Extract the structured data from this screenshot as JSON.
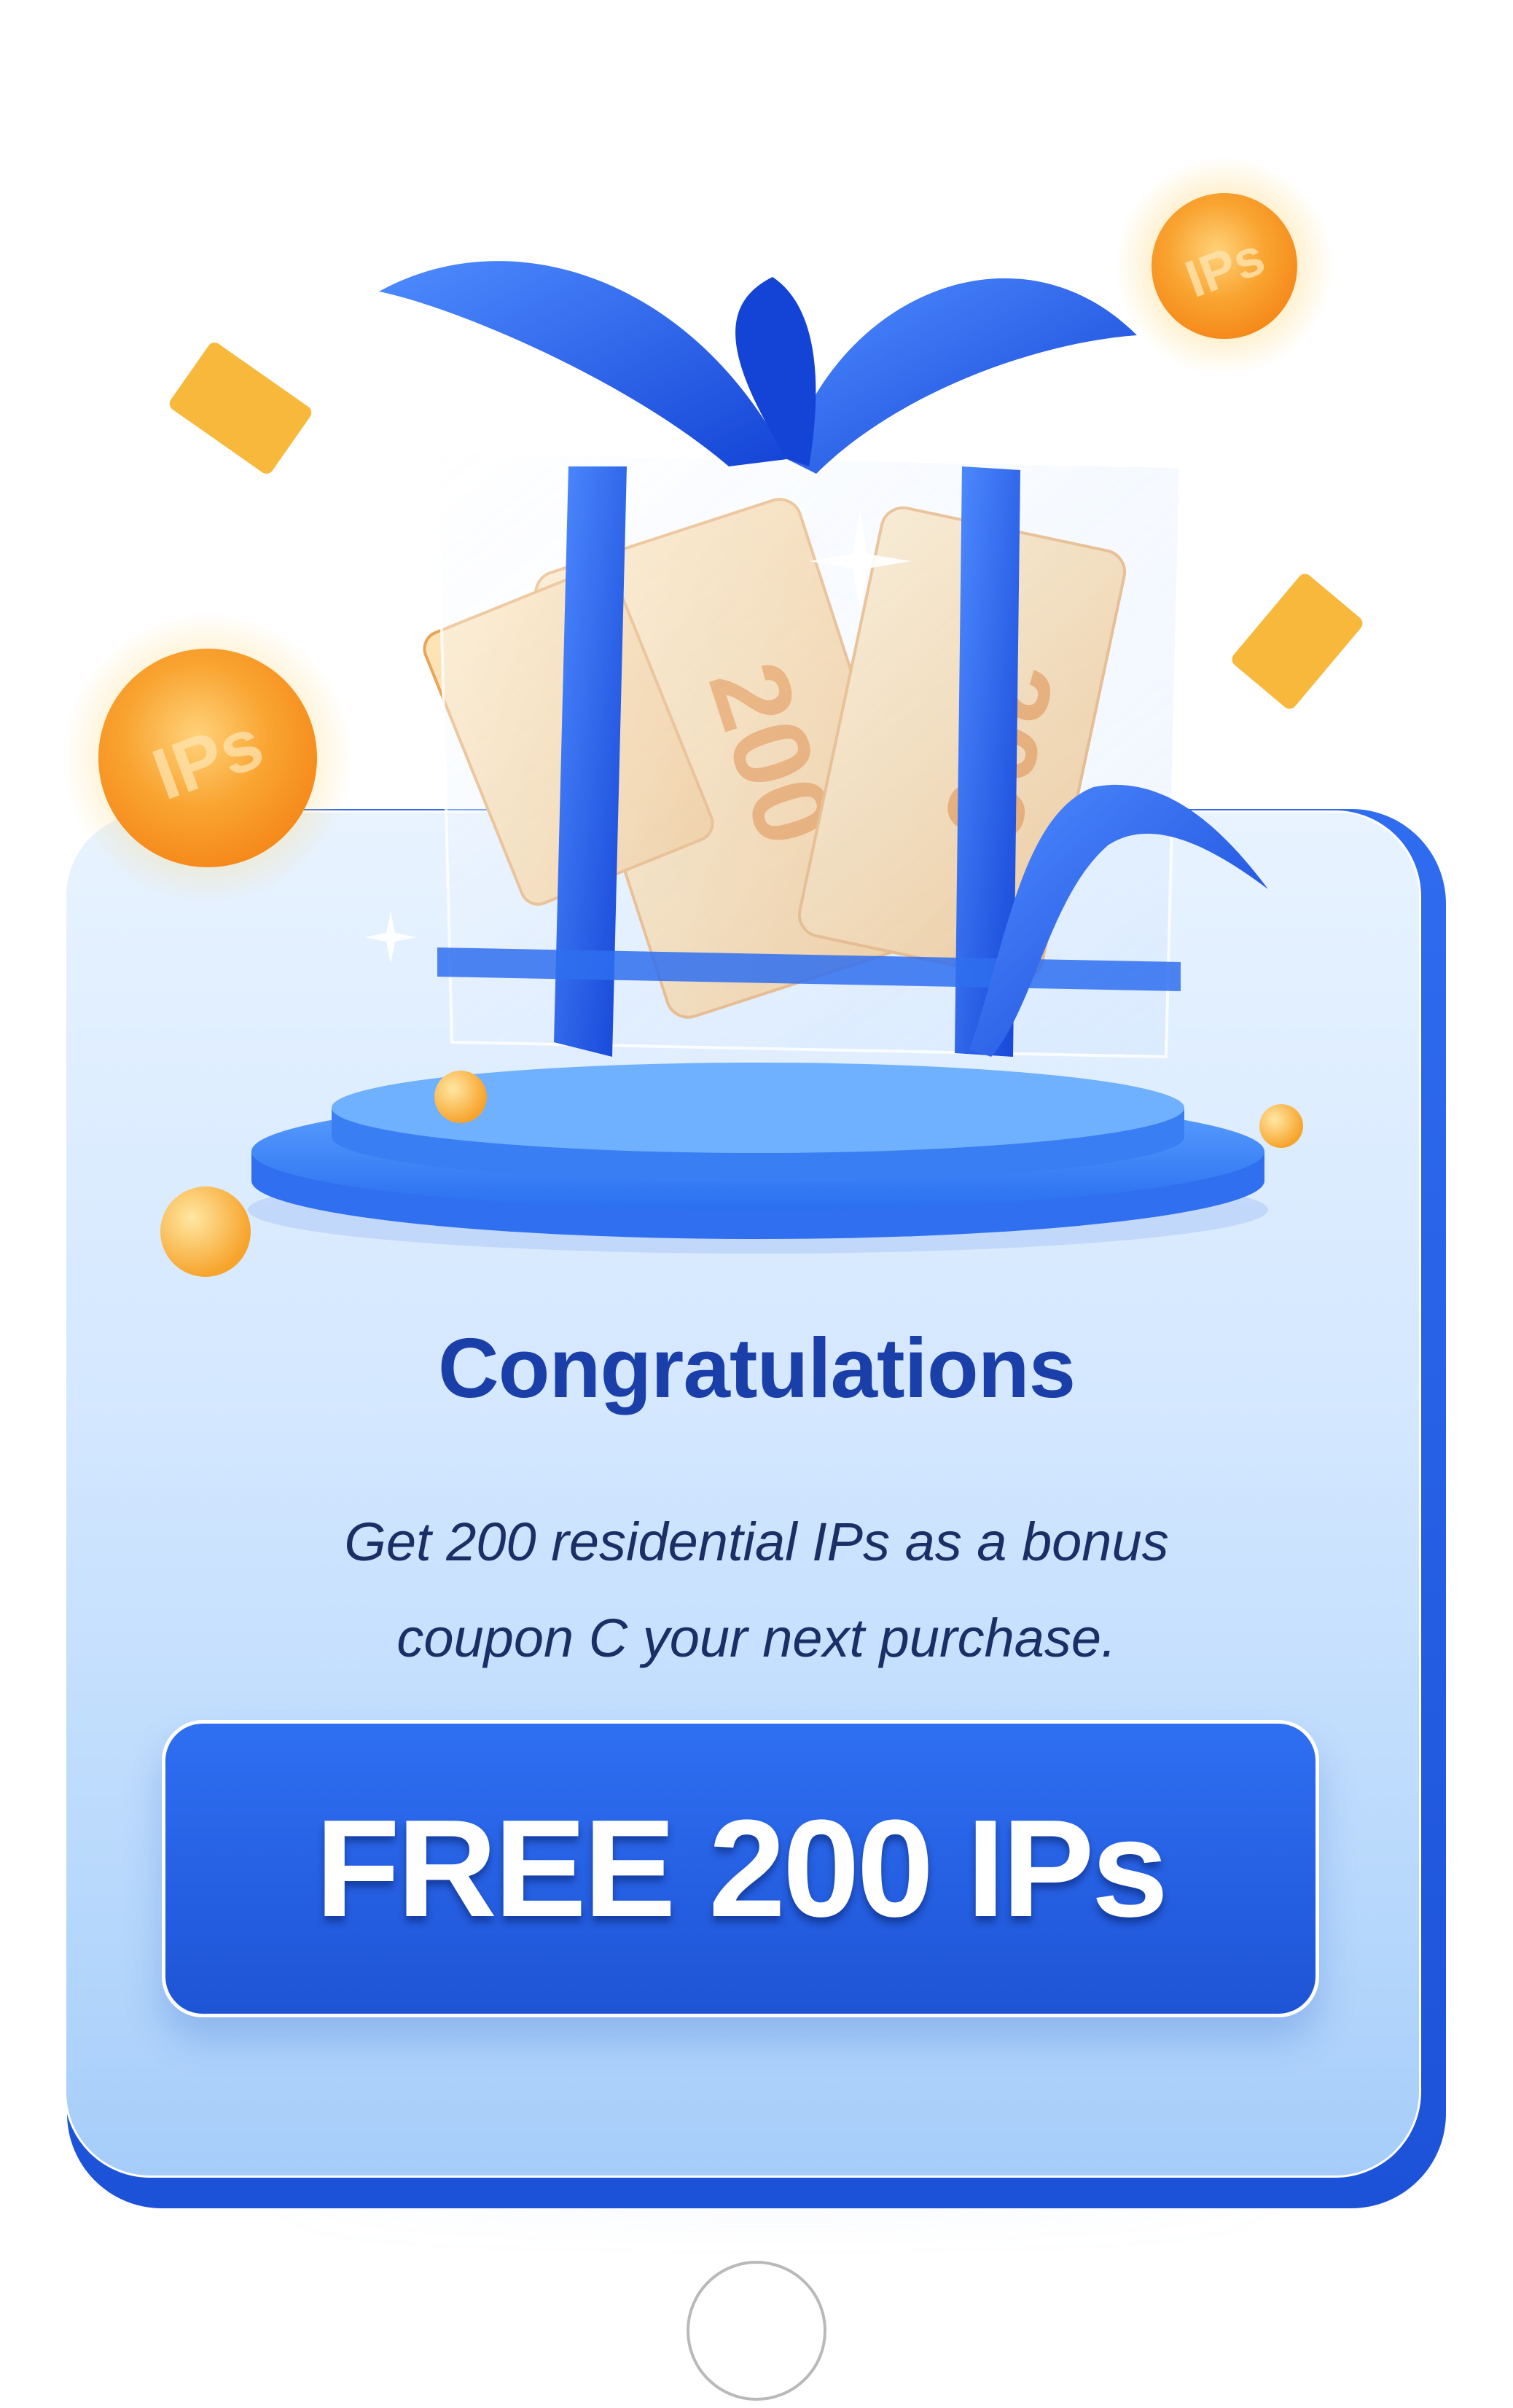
{
  "popup": {
    "title": "Congratulations",
    "message_line1": "Get 200 residential IPs as a bonus",
    "message_line2": "coupon C your next purchase.",
    "cta_label": "FREE 200 IPs"
  },
  "illustration": {
    "coupon_value": "200",
    "coin_label": "IPs",
    "accent_color": "#1e54d6",
    "gold_color": "#f7a93a"
  },
  "icons": {
    "gift": "gift-box-icon",
    "coin": "coin-icon",
    "ticket": "ticket-icon",
    "close": "close-icon"
  }
}
